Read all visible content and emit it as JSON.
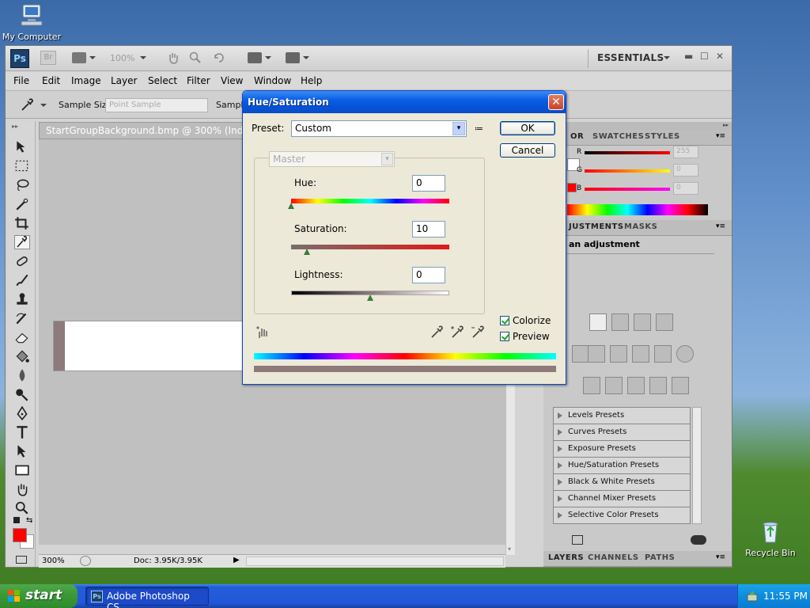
{
  "desktop": {
    "my_computer_label": "My Computer",
    "recycle_bin_label": "Recycle Bin"
  },
  "photoshop": {
    "app_logo": "Ps",
    "bridge_logo": "Br",
    "zoom_level": "100%",
    "workspace": "ESSENTIALS",
    "menu": [
      "File",
      "Edit",
      "Image",
      "Layer",
      "Select",
      "Filter",
      "View",
      "Window",
      "Help"
    ],
    "options": {
      "sample_size_label": "Sample Size:",
      "sample_size_value": "Point Sample",
      "sample_label": "Sample"
    },
    "document": {
      "tab_title": "StartGroupBackground.bmp @ 300% (Index",
      "status_zoom": "300%",
      "doc_info": "Doc: 3.95K/3.95K"
    },
    "panels": {
      "color_tabs": [
        "OR",
        "SWATCHES",
        "STYLES"
      ],
      "color_sliders": [
        {
          "label": "R",
          "value": "255"
        },
        {
          "label": "G",
          "value": "0"
        },
        {
          "label": "B",
          "value": "0"
        }
      ],
      "adjust_tabs": [
        "JUSTMENTS",
        "MASKS"
      ],
      "adjust_hint": "an adjustment",
      "presets": [
        "Levels Presets",
        "Curves Presets",
        "Exposure Presets",
        "Hue/Saturation Presets",
        "Black & White Presets",
        "Channel Mixer Presets",
        "Selective Color Presets"
      ],
      "layers_tabs": [
        "LAYERS",
        "CHANNELS",
        "PATHS"
      ]
    },
    "colors": {
      "foreground": "#ff0000",
      "background": "#ffffff"
    }
  },
  "dialog": {
    "title": "Hue/Saturation",
    "close_glyph": "✕",
    "preset_label": "Preset:",
    "preset_value": "Custom",
    "ok_label": "OK",
    "cancel_label": "Cancel",
    "channel_value": "Master",
    "hue_label": "Hue:",
    "hue_value": "0",
    "saturation_label": "Saturation:",
    "saturation_value": "10",
    "lightness_label": "Lightness:",
    "lightness_value": "0",
    "colorize_label": "Colorize",
    "colorize_checked": true,
    "preview_label": "Preview",
    "preview_checked": true
  },
  "taskbar": {
    "start_label": "start",
    "task_label": "Adobe Photoshop CS...",
    "time": "11:55 PM"
  }
}
